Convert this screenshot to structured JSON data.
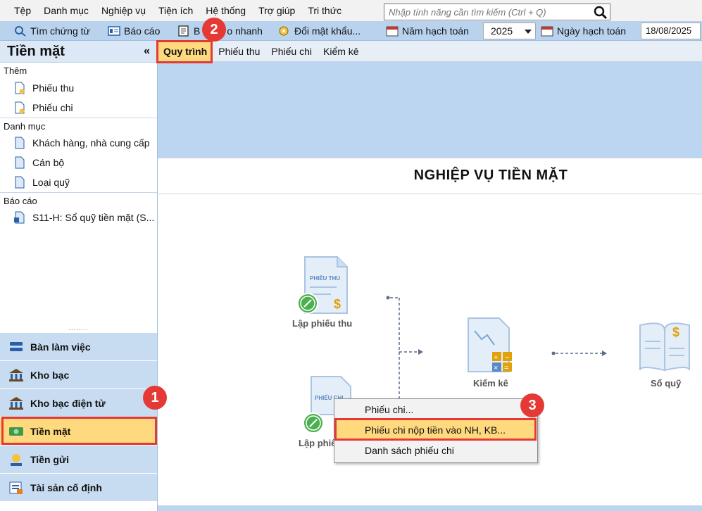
{
  "menubar": {
    "items": [
      "Tệp",
      "Danh mục",
      "Nghiệp vụ",
      "Tiện ích",
      "Hệ thống",
      "Trợ giúp",
      "Tri thức"
    ],
    "search_placeholder": "Nhập tính năng cần tìm kiếm (Ctrl + Q)"
  },
  "toolbar": {
    "search_voucher": "Tìm chứng từ",
    "report": "Báo cáo",
    "quick_report_prefix": "B",
    "quick_report_suffix": "o nhanh",
    "change_password": "Đổi mật khẩu...",
    "fiscal_year_label": "Năm hạch toán",
    "fiscal_year_value": "2025",
    "posting_date_label": "Ngày hạch toán",
    "posting_date_value": "18/08/2025"
  },
  "sidebar": {
    "title": "Tiền mặt",
    "collapse": "«",
    "groups": [
      {
        "label": "Thêm",
        "items": [
          "Phiếu thu",
          "Phiếu chi"
        ]
      },
      {
        "label": "Danh mục",
        "items": [
          "Khách hàng, nhà cung cấp",
          "Cán bộ",
          "Loại quỹ"
        ]
      },
      {
        "label": "Báo cáo",
        "items": [
          "S11-H: Sổ quỹ tiền mặt (S..."
        ]
      }
    ],
    "grip": "........"
  },
  "modules": [
    {
      "label": "Bàn làm việc",
      "icon": "desk-icon"
    },
    {
      "label": "Kho bạc",
      "icon": "bank-icon"
    },
    {
      "label": "Kho bạc điện tử",
      "icon": "bank-icon"
    },
    {
      "label": "Tiền mặt",
      "icon": "cash-icon",
      "active": true
    },
    {
      "label": "Tiền gửi",
      "icon": "deposit-icon"
    },
    {
      "label": "Tài sản cố định",
      "icon": "asset-icon"
    }
  ],
  "tabs": [
    "Quy trình",
    "Phiếu thu",
    "Phiếu chi",
    "Kiểm kê"
  ],
  "main": {
    "title": "NGHIỆP VỤ TIỀN MẶT",
    "flow": {
      "receipt_label": "Lập phiếu thu",
      "receipt_doc_text": "PHIẾU THU",
      "payment_label": "Lập phiế",
      "payment_doc_text": "PHIẾU CHI",
      "inventory_label": "Kiểm kê",
      "ledger_label": "Sổ quỹ"
    }
  },
  "context_menu": {
    "items": [
      "Phiếu chi...",
      "Phiếu chi nộp tiền vào NH, KB...",
      "Danh sách phiếu chi"
    ],
    "highlighted_index": 1
  },
  "annotations": {
    "step1": "1",
    "step2": "2",
    "step3": "3",
    "color": "#e53935"
  }
}
